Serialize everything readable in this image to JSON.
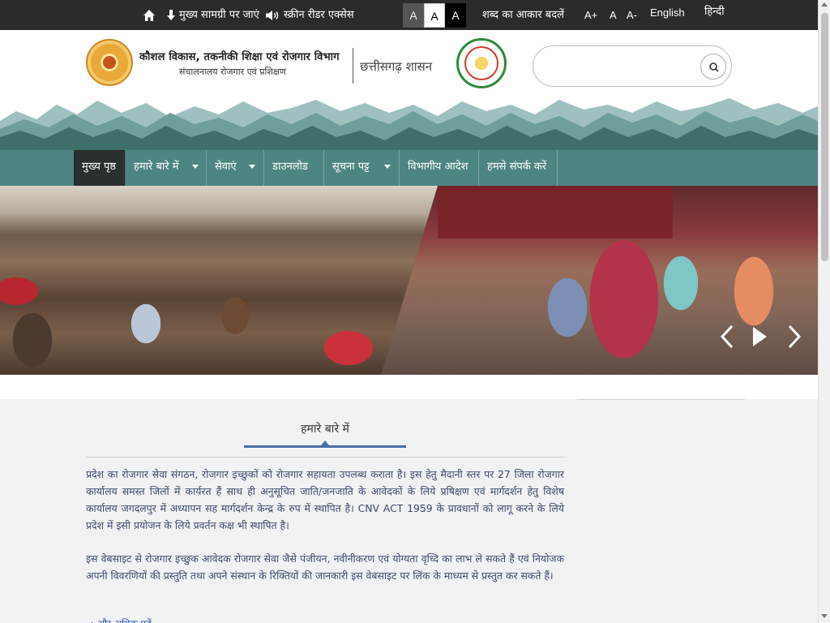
{
  "topbar": {
    "skip_to_content": "मुख्य सामग्री पर जाएं",
    "screen_reader": "स्क्रीन रीडर एक्सेस",
    "contrast_options": [
      "A",
      "A",
      "A"
    ],
    "font_size_label": "शब्द का आकार बदलें",
    "font_increase": "A+",
    "font_normal": "A",
    "font_decrease": "A-",
    "lang_english": "English",
    "lang_hindi": "हिन्दी"
  },
  "header": {
    "dept_name": "कौशल विकास, तकनीकी शिक्षा एवं रोजगार विभाग",
    "dept_sub": "संचालनालय रोजगार एवं प्रशिक्षण",
    "gov_name": "छत्तीसगढ़ शासन",
    "search_placeholder": ""
  },
  "nav": {
    "items": [
      {
        "label": "मुख्य पृष्ठ",
        "active": true,
        "dropdown": false
      },
      {
        "label": "हमारे बारे में",
        "active": false,
        "dropdown": true
      },
      {
        "label": "सेवाएं",
        "active": false,
        "dropdown": true
      },
      {
        "label": "डाउनलोड",
        "active": false,
        "dropdown": false
      },
      {
        "label": "सूचना पट्ट",
        "active": false,
        "dropdown": true
      },
      {
        "label": "विभागीय आदेश",
        "active": false,
        "dropdown": false
      },
      {
        "label": "हमसे संपर्क करें",
        "active": false,
        "dropdown": false
      }
    ]
  },
  "slider": {
    "controls": [
      "chevron-left-icon",
      "play-icon",
      "chevron-right-icon"
    ]
  },
  "about": {
    "title": "हमारे बारे में",
    "para1": "प्रदेश का रोजगार सेवा संगठन, रोजगार इच्छुकों को रोजगार सहायता उपलब्ध कराता है। इस हेतु मैदानी स्तर पर 27 जिला रोजगार कार्यालय समस्त जिलों में कार्यरत हैं साथ ही अनुसूचित जाति/जनजाति के आवेदकों के लिये प्रषिक्षण एवं मार्गदर्शन हेतु विशेष कार्यालय जगदलपुर में अध्यापन सह मार्गदर्शन केन्द्र के रुप में स्थापित है। CNV ACT 1959 के प्रावधानों को लागू करने के लिये प्रदेश में इसी प्रयोजन के लिये प्रवर्तन कक्ष भी स्थापित है।",
    "para2": "इस वेबसाइट से रोजगार इच्छुक आवेदक रोजगार सेवा जैसे पंजीयन, नवीनीकरण एवं योग्यता वृध्दि का लाभ ले सकते हैं एवं नियोजक अपनी विवरणियों की प्रस्तुति तथा अपने संस्थान के रिक्तियों की जानकारी इस वेबसाइट पर लिंक के माध्यम से प्रस्तुत कर सकते हैं।",
    "more_link": "→ और अधिक पढ़ें"
  },
  "colors": {
    "topbar_bg": "#2b2b2b",
    "nav_bg": "#4d8582",
    "nav_active_bg": "#2a2f2f",
    "accent_blue": "#4a6fa5"
  }
}
